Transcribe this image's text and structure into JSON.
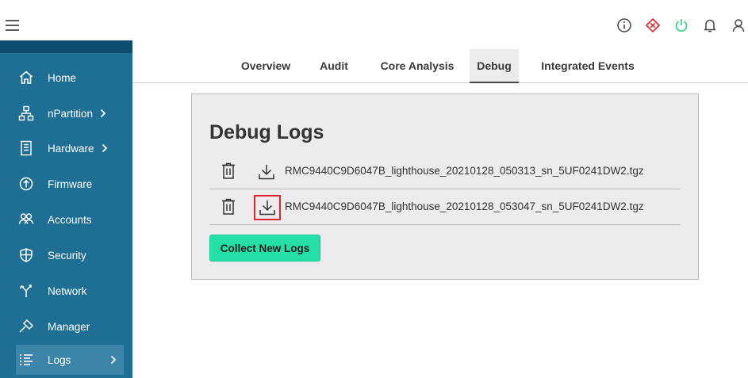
{
  "colors": {
    "sidebar_bg": "#1f6f95",
    "sidebar_header_bg": "#0e4f71",
    "sidebar_active_bg": "#3d85a8",
    "panel_bg": "#ececec",
    "accent_button": "#25e0a6",
    "highlight_border": "#e0242b",
    "alert_icon": "#e0242b",
    "power_icon": "#2ad17a"
  },
  "topbar": {
    "menu_icon": "hamburger-icon",
    "icons": [
      "info-icon",
      "alert-diamond-icon",
      "power-icon",
      "bell-icon",
      "user-icon"
    ]
  },
  "sidebar": {
    "items": [
      {
        "label": "Home",
        "icon": "home-icon"
      },
      {
        "label": "nPartition",
        "icon": "partition-icon",
        "has_chevron": true
      },
      {
        "label": "Hardware",
        "icon": "hardware-icon",
        "has_chevron": true
      },
      {
        "label": "Firmware",
        "icon": "firmware-icon"
      },
      {
        "label": "Accounts",
        "icon": "accounts-icon"
      },
      {
        "label": "Security",
        "icon": "security-icon"
      },
      {
        "label": "Network",
        "icon": "network-icon"
      },
      {
        "label": "Manager",
        "icon": "manager-icon"
      },
      {
        "label": "Logs",
        "icon": "logs-icon",
        "has_chevron": true,
        "active": true
      }
    ]
  },
  "tabs": {
    "items": [
      {
        "label": "Overview"
      },
      {
        "label": "Audit"
      },
      {
        "label": "Core Analysis"
      },
      {
        "label": "Debug",
        "active": true
      },
      {
        "label": "Integrated Events"
      }
    ]
  },
  "panel": {
    "title": "Debug Logs",
    "logs": [
      {
        "filename": "RMC9440C9D6047B_lighthouse_20210128_050313_sn_5UF0241DW2.tgz",
        "highlighted": false
      },
      {
        "filename": "RMC9440C9D6047B_lighthouse_20210128_053047_sn_5UF0241DW2.tgz",
        "highlighted": true
      }
    ],
    "collect_button_label": "Collect New Logs"
  }
}
